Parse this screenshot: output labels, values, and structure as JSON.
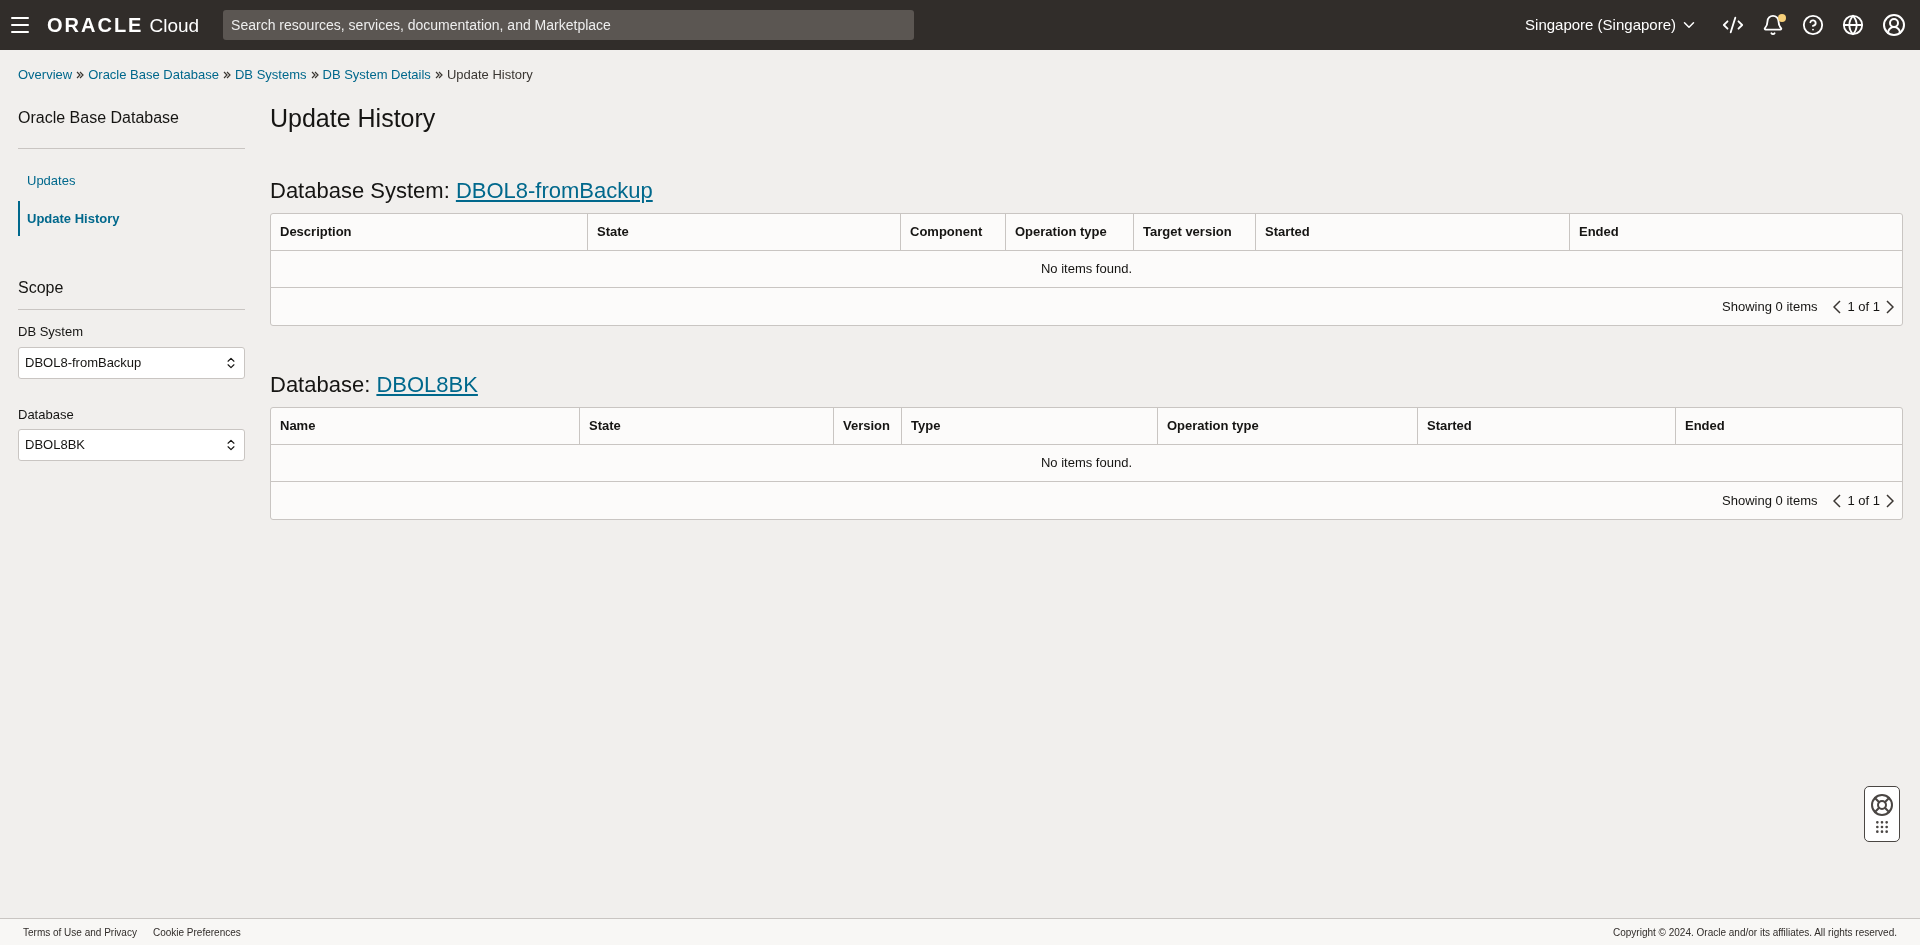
{
  "header": {
    "logo_brand": "ORACLE",
    "logo_product": "Cloud",
    "search": {
      "placeholder": "Search resources, services, documentation, and Marketplace"
    },
    "region": "Singapore (Singapore)",
    "notification_dot": true
  },
  "breadcrumbs": [
    {
      "label": "Overview",
      "link": true
    },
    {
      "label": "Oracle Base Database",
      "link": true
    },
    {
      "label": "DB Systems",
      "link": true
    },
    {
      "label": "DB System Details",
      "link": true
    },
    {
      "label": "Update History",
      "link": false
    }
  ],
  "sidebar": {
    "title": "Oracle Base Database",
    "items": [
      {
        "label": "Updates",
        "selected": false
      },
      {
        "label": "Update History",
        "selected": true
      }
    ],
    "scope_title": "Scope",
    "selects": [
      {
        "label": "DB System",
        "value": "DBOL8-fromBackup"
      },
      {
        "label": "Database",
        "value": "DBOL8BK"
      }
    ]
  },
  "page_title": "Update History",
  "sections": [
    {
      "heading": "Database System: ",
      "link": "DBOL8-fromBackup",
      "columns": [
        "Description",
        "State",
        "Component",
        "Operation type",
        "Target version",
        "Started",
        "Ended"
      ],
      "empty": "No items found.",
      "showing": "Showing 0 items",
      "pages": "1 of 1"
    },
    {
      "heading": "Database: ",
      "link": "DBOL8BK",
      "columns": [
        "Name",
        "State",
        "Version",
        "Type",
        "Operation type",
        "Started",
        "Ended"
      ],
      "empty": "No items found.",
      "showing": "Showing 0 items",
      "pages": "1 of 1"
    }
  ],
  "footer": {
    "links": [
      "Terms of Use and Privacy",
      "Cookie Preferences"
    ],
    "copyright": "Copyright © 2024. Oracle and/or its affiliates. All rights reserved."
  }
}
